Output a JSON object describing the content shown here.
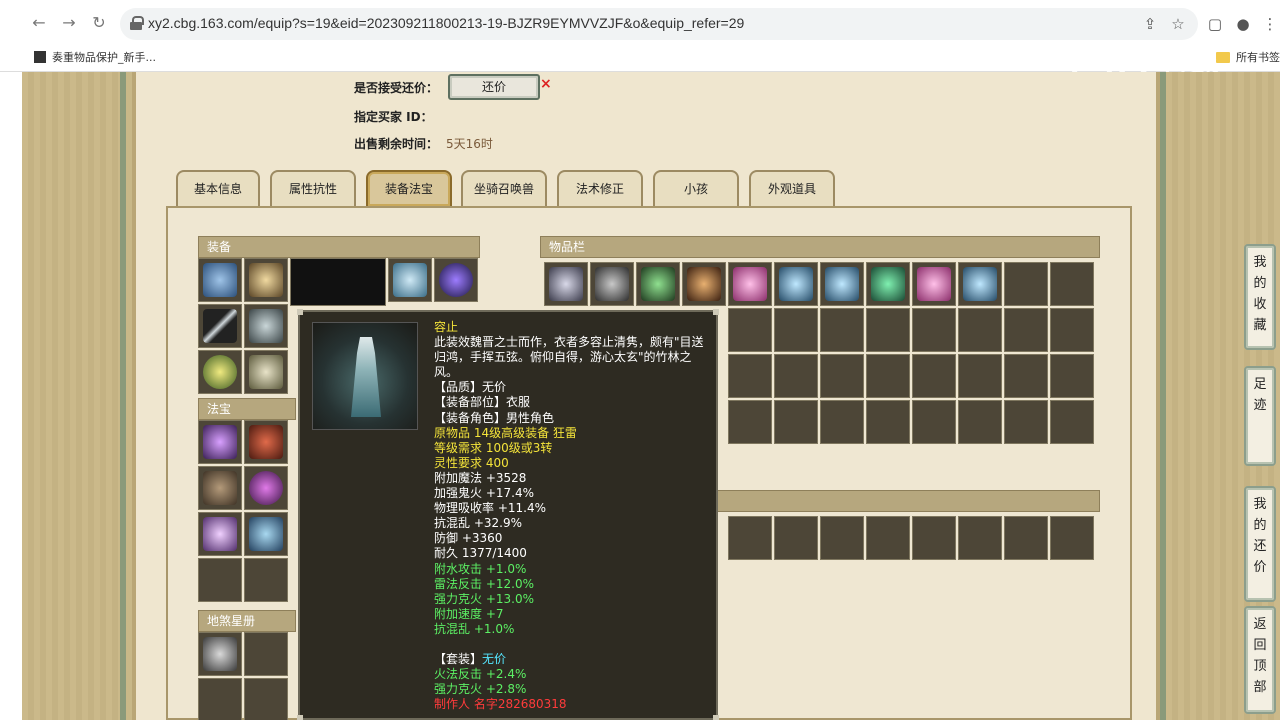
{
  "browser": {
    "url": "xy2.cbg.163.com/equip?s=19&eid=202309211800213-19-BJZR9EYMVVZJF&o&equip_refer=29",
    "bookmark_left": "奏重物品保护_新手...",
    "bookmark_right": "所有书签"
  },
  "watermark": "CC直播",
  "info": {
    "accept_counter_label": "是否接受还价：",
    "counter_button": "还价",
    "buyer_label": "指定买家 ID：",
    "time_label": "出售剩余时间：",
    "time_value": "5天16时"
  },
  "tabs": [
    "基本信息",
    "属性抗性",
    "装备法宝",
    "坐骑召唤兽",
    "法术修正",
    "小孩",
    "外观道具"
  ],
  "sections": {
    "equip": "装备",
    "fabao": "法宝",
    "dishaxingce": "地煞星册",
    "inventory": "物品栏"
  },
  "tooltip": {
    "name": "容止",
    "desc1": "此装效魏晋之士而作，衣者多容止清隽，颇有\"目送",
    "desc2": "归鸿，手挥五弦。俯仰自得，游心太玄\"的竹林之",
    "desc3": "风。",
    "quality": "【品质】无价",
    "slot": "【装备部位】衣服",
    "role": "【装备角色】男性角色",
    "origin": "原物品 14级高级装备 狂雷",
    "level_req": "等级需求 100级或3转",
    "spirit_req": "灵性要求 400",
    "stats_white": [
      "附加魔法 +3528",
      "加强鬼火 +17.4%",
      "物理吸收率 +11.4%",
      "抗混乱 +32.9%",
      "防御 +3360",
      "耐久 1377/1400"
    ],
    "stats_green": [
      "附水攻击 +1.0%",
      "雷法反击 +12.0%",
      "强力克火 +13.0%",
      "附加速度 +7",
      "抗混乱 +1.0%"
    ],
    "set_label": "【套装】",
    "set_value": "无价",
    "set_stats": [
      "火法反击 +2.4%",
      "强力克火 +2.8%"
    ],
    "maker": "制作人 名字282680318"
  },
  "side_tabs": [
    [
      "我",
      "的",
      "收",
      "藏"
    ],
    [
      "足",
      "迹"
    ],
    [
      "我",
      "的",
      "还",
      "价"
    ],
    [
      "返",
      "回",
      "顶",
      "部"
    ]
  ],
  "colors": {
    "accent_yellow": "#f4e43a",
    "stat_green": "#5cf064",
    "maker_red": "#ff3b3b"
  }
}
